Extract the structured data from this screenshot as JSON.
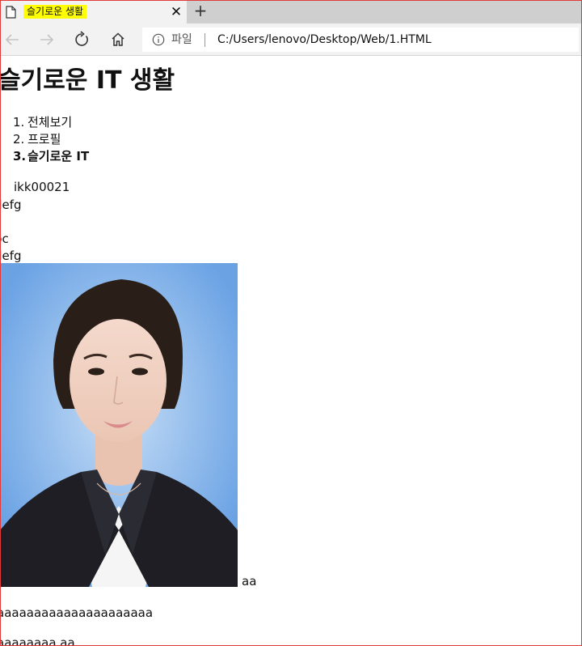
{
  "browser": {
    "tab": {
      "title": "슬기로운 생활"
    },
    "address": {
      "scheme": "파일",
      "url": "C:/Users/lenovo/Desktop/Web/1.HTML"
    }
  },
  "page": {
    "heading": "슬기로운 IT 생활",
    "nav": [
      {
        "num": "1.",
        "label": "전체보기"
      },
      {
        "num": "2.",
        "label": "프로필"
      },
      {
        "num": "3.",
        "label": "슬기로운 IT"
      }
    ],
    "lines": {
      "id": "ikk00021",
      "line1": "defg",
      "line2": "bc",
      "line3": "defg",
      "after_photo": "aa",
      "row1": "aaaaaaaaaaaaaaaaaaaaa",
      "row2": "aaaaaaaa aa"
    }
  },
  "colors": {
    "tab_highlight": "#ffff00",
    "frame": "#e03a3a"
  }
}
